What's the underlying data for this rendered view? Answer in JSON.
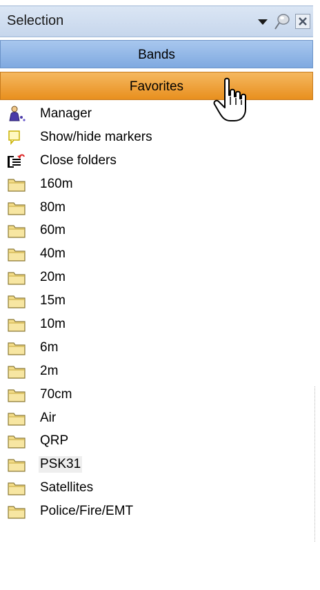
{
  "panel": {
    "title": "Selection",
    "controls": {
      "dropdown_icon": "chevron-down-icon",
      "pin_icon": "pin-icon",
      "close_icon": "close-icon"
    }
  },
  "tabs": {
    "bands_label": "Bands",
    "favorites_label": "Favorites",
    "active": "Favorites"
  },
  "colors": {
    "bands_bar": "#8fb5e6",
    "favorites_bar": "#ee9f34",
    "title_bar": "#cfdcef",
    "folder_fill": "#f3dc88"
  },
  "actions": [
    {
      "label": "Manager",
      "icon": "manager-icon"
    },
    {
      "label": "Show/hide markers",
      "icon": "marker-icon"
    },
    {
      "label": "Close folders",
      "icon": "close-folders-icon"
    }
  ],
  "folders": [
    {
      "label": "160m"
    },
    {
      "label": "80m"
    },
    {
      "label": "60m"
    },
    {
      "label": "40m"
    },
    {
      "label": "20m"
    },
    {
      "label": "15m"
    },
    {
      "label": "10m"
    },
    {
      "label": "6m"
    },
    {
      "label": "2m"
    },
    {
      "label": "70cm"
    },
    {
      "label": "Air"
    },
    {
      "label": "QRP"
    },
    {
      "label": "PSK31",
      "highlighted": true
    },
    {
      "label": "Satellites"
    },
    {
      "label": "Police/Fire/EMT"
    }
  ]
}
